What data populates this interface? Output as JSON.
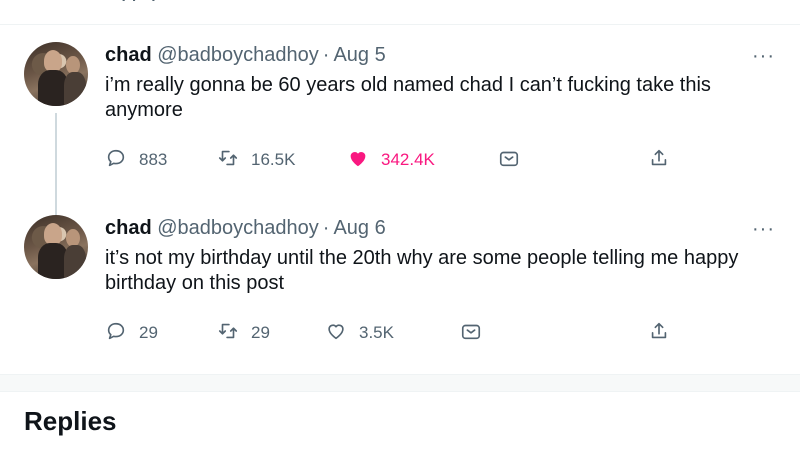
{
  "tweets": [
    {
      "name": "chad",
      "handle": "@badboychadhoy",
      "separator": "·",
      "date": "Aug 5",
      "text": "i’m really gonna be 60 years old named chad I can’t fucking take this anymore",
      "replies": "883",
      "retweets": "16.5K",
      "likes": "342.4K",
      "liked": true,
      "more": "···"
    },
    {
      "name": "chad",
      "handle": "@badboychadhoy",
      "separator": "·",
      "date": "Aug 6",
      "text": "it’s not my birthday until the 20th why are some people telling me happy birthday on this post",
      "replies": "29",
      "retweets": "29",
      "likes": "3.5K",
      "liked": false,
      "more": "···"
    }
  ],
  "section": {
    "replies_title": "Replies"
  },
  "colors": {
    "like_active": "#f91880",
    "muted": "#536471",
    "thread_line": "#cfd9de"
  },
  "icons": {
    "reply": "reply-icon",
    "retweet": "retweet-icon",
    "like": "heart-icon",
    "bookmark": "bookmark-icon",
    "share": "share-icon",
    "more": "more-icon"
  }
}
